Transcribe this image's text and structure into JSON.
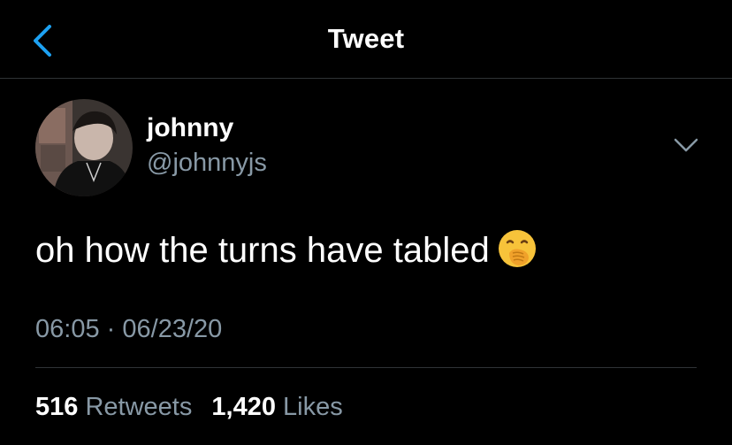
{
  "header": {
    "title": "Tweet",
    "back_icon": "chevron-left-icon",
    "accent_color": "#1da1f2"
  },
  "tweet": {
    "author": {
      "name": "johnny",
      "handle": "@johnnyjs"
    },
    "text": "oh how the turns have tabled",
    "emoji": "face-with-hand-over-mouth-icon",
    "time": "06:05",
    "separator": "·",
    "date": "06/23/20",
    "stats": {
      "retweets_count": "516",
      "retweets_label": "Retweets",
      "likes_count": "1,420",
      "likes_label": "Likes"
    }
  },
  "colors": {
    "background": "#000000",
    "text": "#ffffff",
    "secondary_text": "#8899a6",
    "divider": "#2f3336"
  }
}
